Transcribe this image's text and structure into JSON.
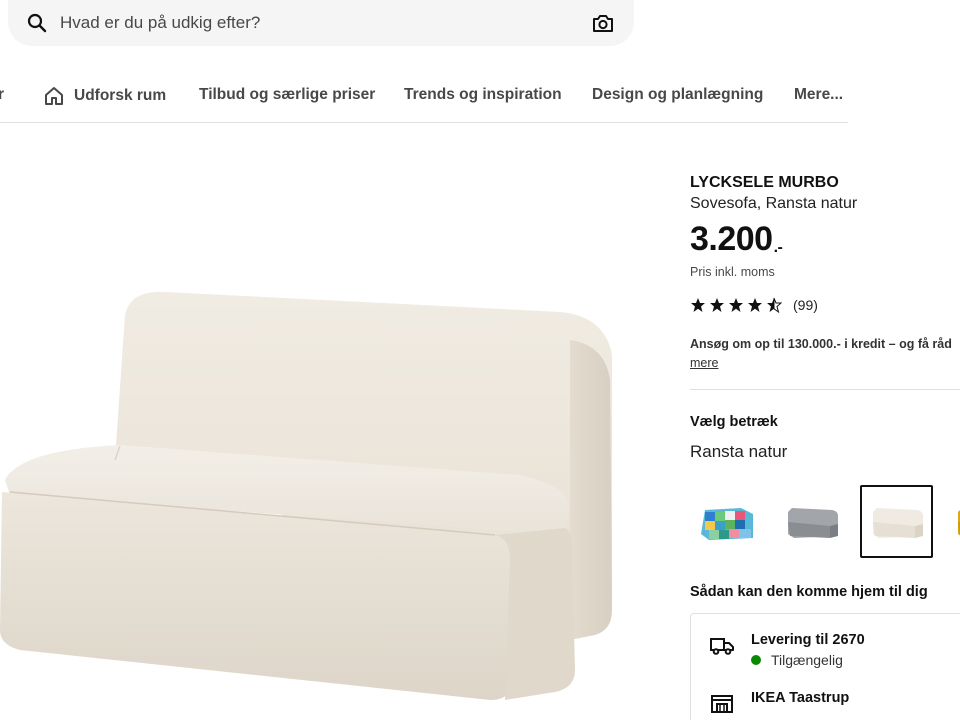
{
  "search": {
    "placeholder": "Hvad er du på udkig efter?",
    "icon": "search-icon",
    "camera_icon": "camera-icon"
  },
  "nav": {
    "partial_item": "r",
    "items": [
      {
        "label": "Udforsk rum",
        "icon": "home-icon"
      },
      {
        "label": "Tilbud og særlige priser"
      },
      {
        "label": "Trends og inspiration"
      },
      {
        "label": "Design og planlægning"
      },
      {
        "label": "Mere..."
      }
    ]
  },
  "product": {
    "name": "LYCKSELE MURBO",
    "description": "Sovesofa, Ransta natur",
    "price": "3.200",
    "price_suffix": ".-",
    "vat_note": "Pris inkl. moms",
    "rating": 4.5,
    "rating_count": "(99)",
    "credit_text": "Ansøg om op til 130.000.- i kredit – og få råd",
    "credit_more": "mere"
  },
  "cover": {
    "heading": "Vælg betræk",
    "selected": "Ransta natur",
    "swatches": [
      {
        "name": "multicolor",
        "color": "#3aa0c8"
      },
      {
        "name": "grey",
        "color": "#8f9296"
      },
      {
        "name": "natural",
        "color": "#ece6da",
        "selected": true
      },
      {
        "name": "yellow",
        "color": "#d4a516"
      }
    ]
  },
  "delivery": {
    "heading": "Sådan kan den komme hjem til dig",
    "options": [
      {
        "title": "Levering til 2670",
        "status": "Tilgængelig",
        "icon": "truck-icon"
      },
      {
        "title": "IKEA Taastrup",
        "icon": "store-icon"
      }
    ]
  },
  "colors": {
    "accent_text": "#111111",
    "muted_text": "#484848",
    "available": "#0a8a00"
  }
}
